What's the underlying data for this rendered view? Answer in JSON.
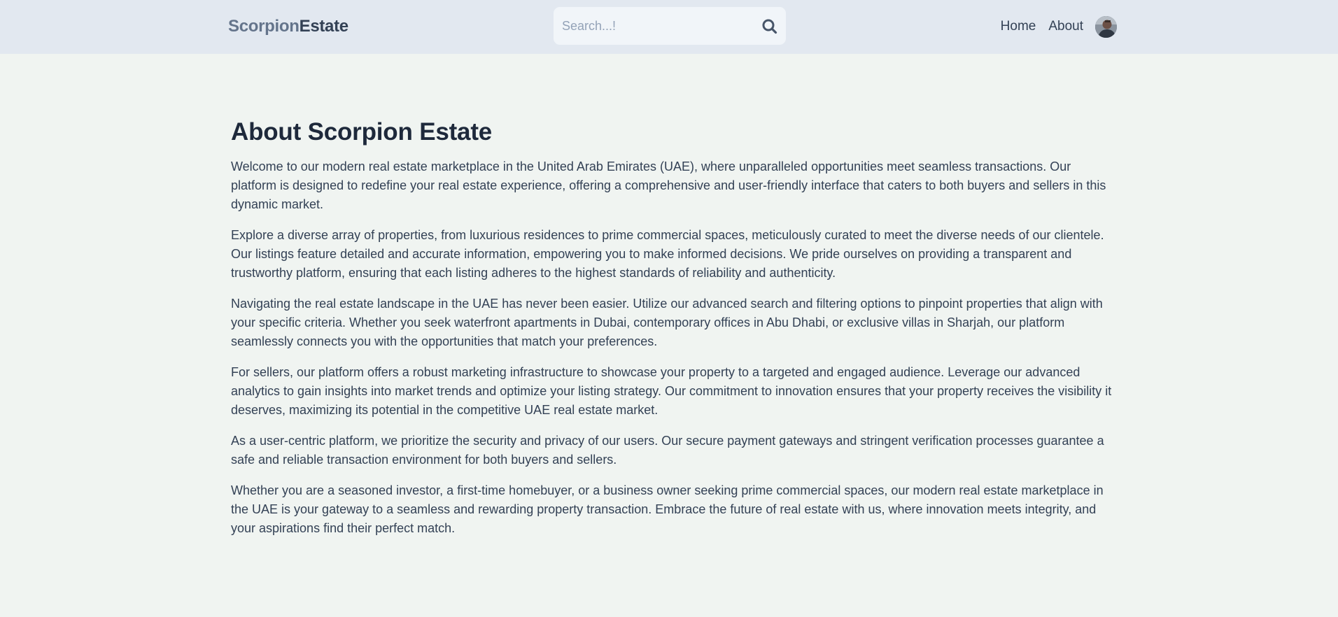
{
  "header": {
    "logo_part1": "Scorpion",
    "logo_part2": "Estate",
    "search": {
      "placeholder": "Search...!",
      "value": "",
      "button_icon": "search-icon"
    },
    "nav": {
      "home_label": "Home",
      "about_label": "About"
    },
    "avatar_icon": "user-avatar"
  },
  "main": {
    "title": "About Scorpion Estate",
    "paragraphs": [
      "Welcome to our modern real estate marketplace in the United Arab Emirates (UAE), where unparalleled opportunities meet seamless transactions. Our platform is designed to redefine your real estate experience, offering a comprehensive and user-friendly interface that caters to both buyers and sellers in this dynamic market.",
      "Explore a diverse array of properties, from luxurious residences to prime commercial spaces, meticulously curated to meet the diverse needs of our clientele. Our listings feature detailed and accurate information, empowering you to make informed decisions. We pride ourselves on providing a transparent and trustworthy platform, ensuring that each listing adheres to the highest standards of reliability and authenticity.",
      "Navigating the real estate landscape in the UAE has never been easier. Utilize our advanced search and filtering options to pinpoint properties that align with your specific criteria. Whether you seek waterfront apartments in Dubai, contemporary offices in Abu Dhabi, or exclusive villas in Sharjah, our platform seamlessly connects you with the opportunities that match your preferences.",
      "For sellers, our platform offers a robust marketing infrastructure to showcase your property to a targeted and engaged audience. Leverage our advanced analytics to gain insights into market trends and optimize your listing strategy. Our commitment to innovation ensures that your property receives the visibility it deserves, maximizing its potential in the competitive UAE real estate market.",
      "As a user-centric platform, we prioritize the security and privacy of our users. Our secure payment gateways and stringent verification processes guarantee a safe and reliable transaction environment for both buyers and sellers.",
      "Whether you are a seasoned investor, a first-time homebuyer, or a business owner seeking prime commercial spaces, our modern real estate marketplace in the UAE is your gateway to a seamless and rewarding property transaction. Embrace the future of real estate with us, where innovation meets integrity, and your aspirations find their perfect match."
    ]
  },
  "colors": {
    "header_bg": "#e2e8f0",
    "page_bg": "#f0f4f1",
    "text": "#334155",
    "heading": "#1e293b",
    "logo_muted": "#64748b"
  }
}
